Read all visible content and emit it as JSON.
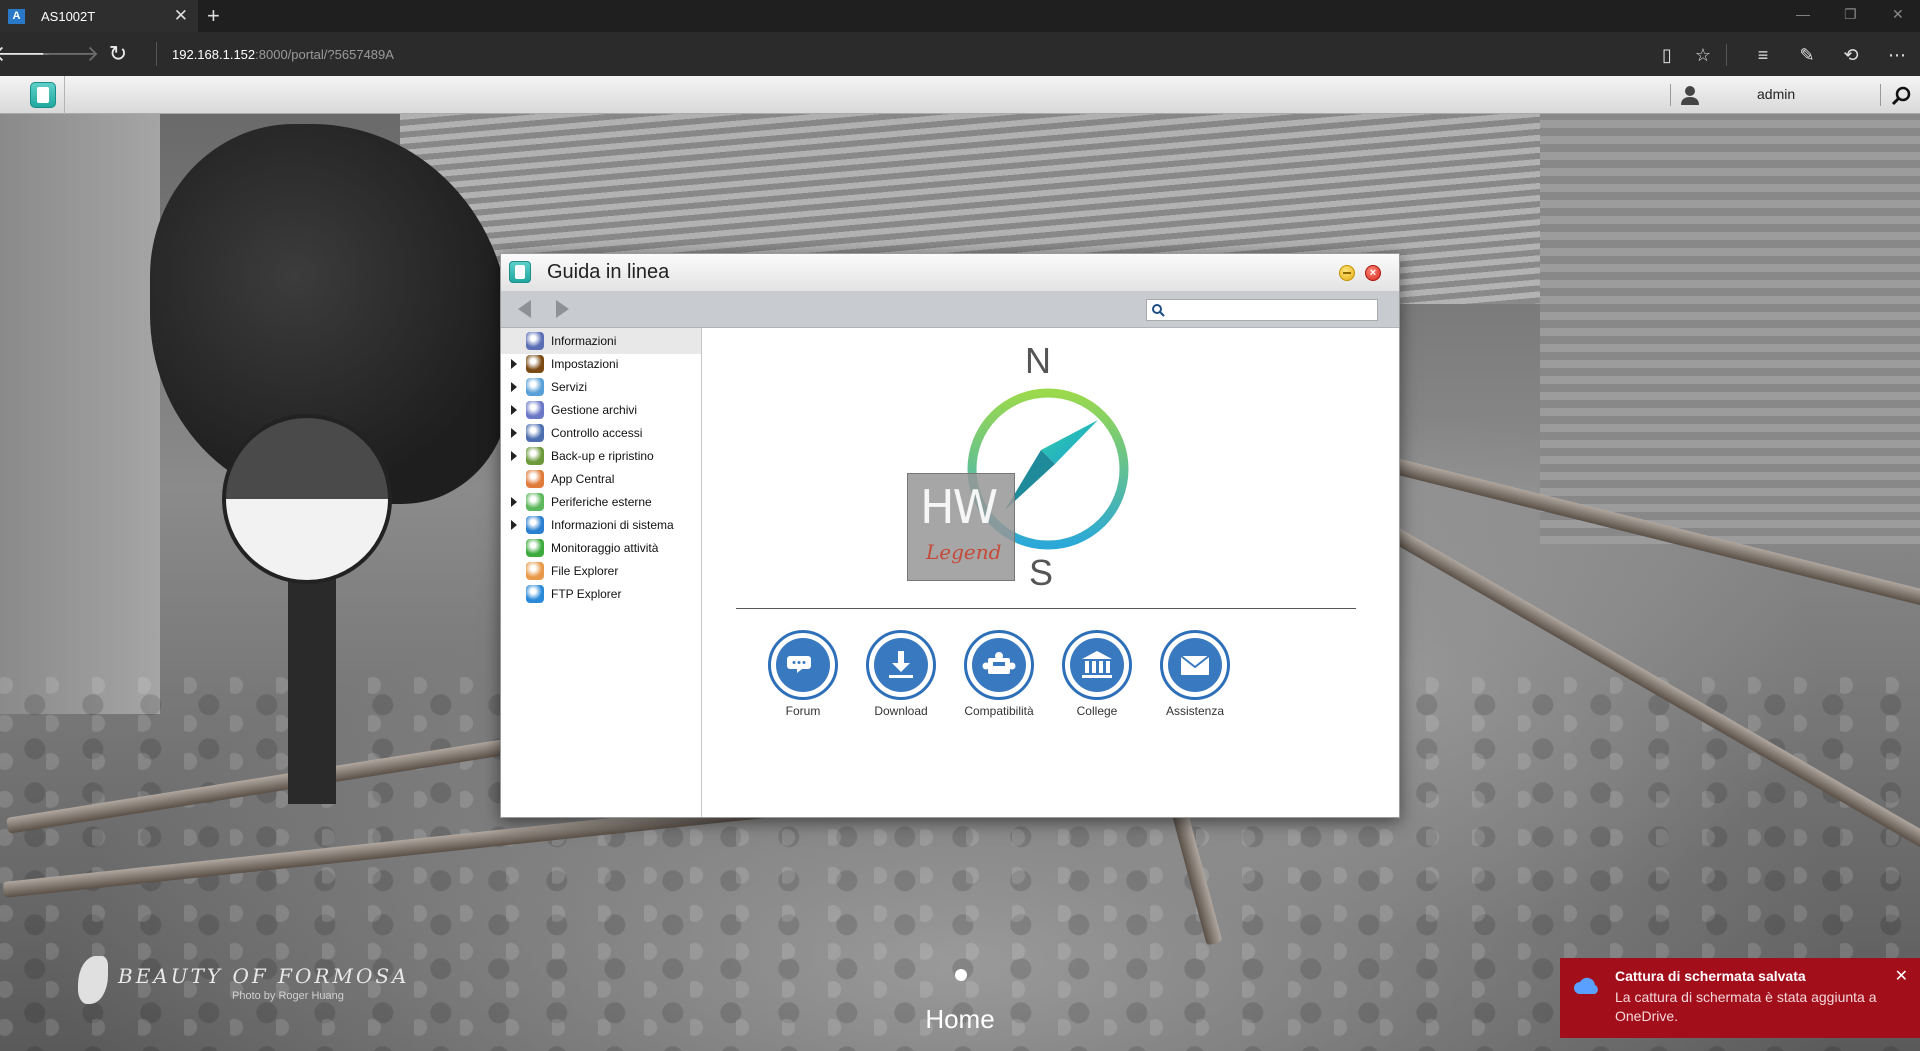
{
  "browser": {
    "tab_title": "AS1002T",
    "tab_favicon": "A",
    "new_tab": "+",
    "url_host": "192.168.1.152",
    "url_rest": ":8000/portal/?5657489A"
  },
  "adm": {
    "username": "admin"
  },
  "help_window": {
    "title": "Guida in linea",
    "search_placeholder": "",
    "nav_items": [
      {
        "label": "Informazioni",
        "icon": "compass-icon",
        "has_children": false,
        "selected": true,
        "color": "#5b6fb5"
      },
      {
        "label": "Impostazioni",
        "icon": "settings-icon",
        "has_children": true,
        "selected": false,
        "color": "#7a4a12"
      },
      {
        "label": "Servizi",
        "icon": "services-icon",
        "has_children": true,
        "selected": false,
        "color": "#5aa0d8"
      },
      {
        "label": "Gestione archivi",
        "icon": "storage-icon",
        "has_children": true,
        "selected": false,
        "color": "#6b78c8"
      },
      {
        "label": "Controllo accessi",
        "icon": "access-control-icon",
        "has_children": true,
        "selected": false,
        "color": "#4d6fb0"
      },
      {
        "label": "Back-up e ripristino",
        "icon": "backup-icon",
        "has_children": true,
        "selected": false,
        "color": "#6c9a3a"
      },
      {
        "label": "App Central",
        "icon": "app-central-icon",
        "has_children": false,
        "selected": false,
        "color": "#e07b39"
      },
      {
        "label": "Periferiche esterne",
        "icon": "external-devices-icon",
        "has_children": true,
        "selected": false,
        "color": "#5cb85c"
      },
      {
        "label": "Informazioni di sistema",
        "icon": "system-info-icon",
        "has_children": true,
        "selected": false,
        "color": "#2a7fd0"
      },
      {
        "label": "Monitoraggio attività",
        "icon": "activity-monitor-icon",
        "has_children": false,
        "selected": false,
        "color": "#3caa3c"
      },
      {
        "label": "File Explorer",
        "icon": "file-explorer-icon",
        "has_children": false,
        "selected": false,
        "color": "#e89a4a"
      },
      {
        "label": "FTP Explorer",
        "icon": "ftp-explorer-icon",
        "has_children": false,
        "selected": false,
        "color": "#2a8ad8"
      }
    ],
    "compass": {
      "north": "N",
      "south": "S"
    },
    "watermark": {
      "hw": "HW",
      "legend": "Legend"
    },
    "links": [
      {
        "label": "Forum",
        "icon": "forum-icon"
      },
      {
        "label": "Download",
        "icon": "download-icon"
      },
      {
        "label": "Compatibilità",
        "icon": "compatibility-icon"
      },
      {
        "label": "College",
        "icon": "college-icon"
      },
      {
        "label": "Assistenza",
        "icon": "support-icon"
      }
    ]
  },
  "desktop": {
    "brand_title": "BEAUTY OF FORMOSA",
    "brand_credit": "Photo by Roger Huang",
    "page_label": "Home"
  },
  "toast": {
    "title": "Cattura di schermata salvata",
    "body": "La cattura di schermata è stata aggiunta a OneDrive."
  }
}
